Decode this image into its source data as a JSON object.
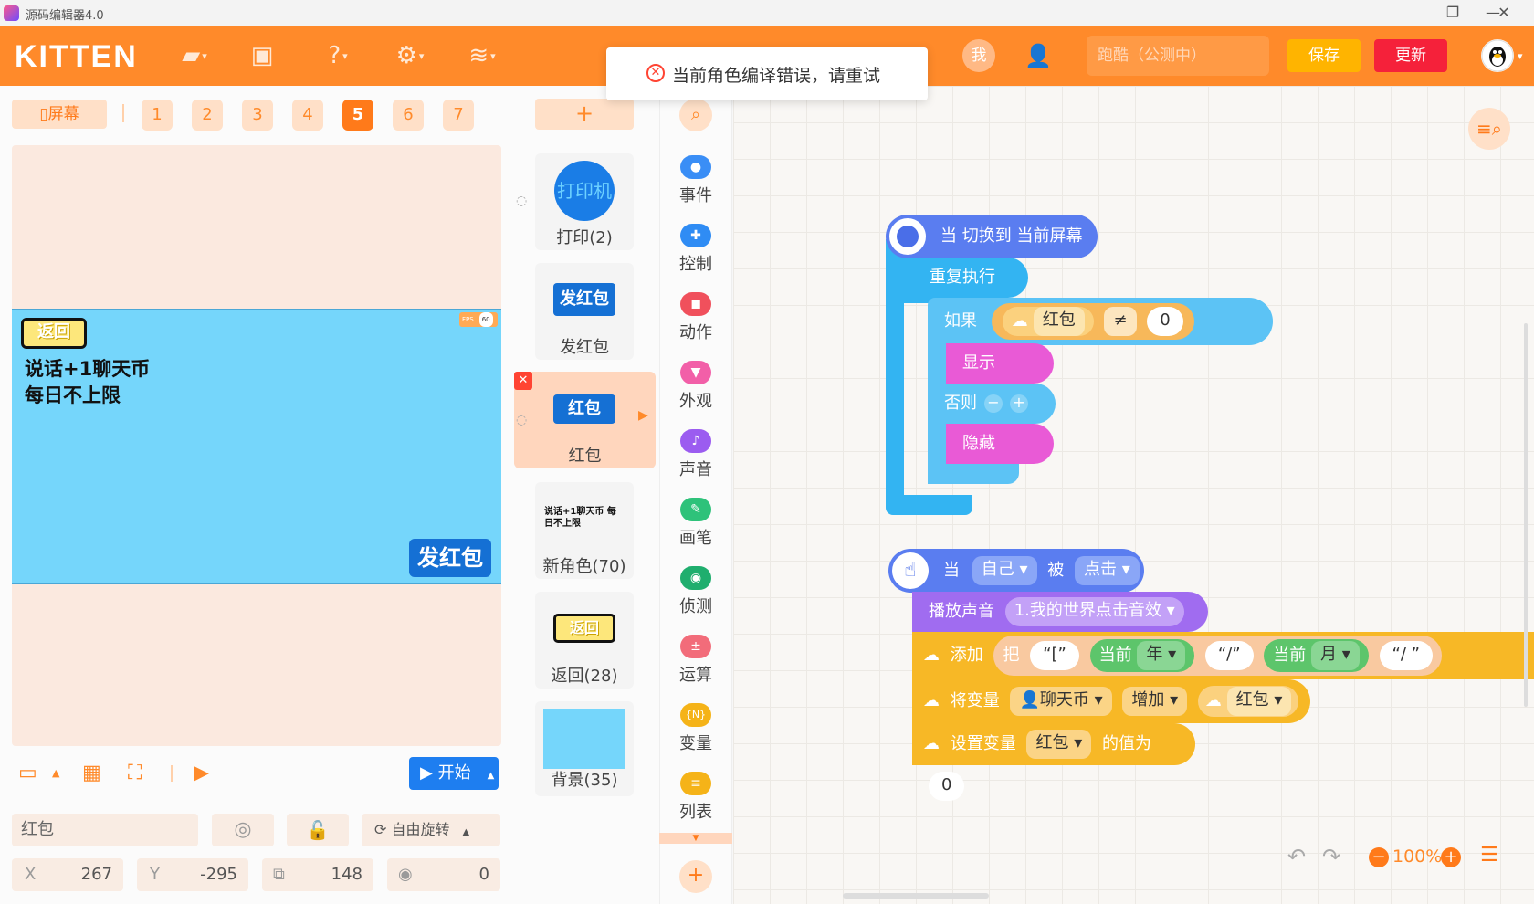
{
  "window": {
    "title": "源码编辑器4.0"
  },
  "header": {
    "logo": "KITTEN",
    "me": "我",
    "project_name": "跑酷（公测中）",
    "save": "保存",
    "update": "更新"
  },
  "toast": {
    "message": "当前角色编译错误，请重试"
  },
  "stage_tabs": {
    "screen": "屏幕",
    "pages": [
      "1",
      "2",
      "3",
      "4",
      "5",
      "6",
      "7"
    ],
    "active": "5"
  },
  "stage": {
    "back_button": "返回",
    "say_lines": [
      "说话+1聊天币",
      "每日不上限"
    ],
    "fps_label": "FPS",
    "fps_value": "60",
    "send_button": "发红包"
  },
  "controls": {
    "start": "开始"
  },
  "properties": {
    "name": "红包",
    "rotation": "自由旋转",
    "x_label": "X",
    "x": "267",
    "y_label": "Y",
    "y": "-295",
    "size": "148",
    "direction": "0"
  },
  "sprites": [
    {
      "thumb": "打印机",
      "label": "打印(2)"
    },
    {
      "thumb": "发红包",
      "label": "发红包"
    },
    {
      "thumb": "红包",
      "label": "红包"
    },
    {
      "thumb": "说话+1聊天币 每日不上限",
      "label": "新角色(70)"
    },
    {
      "thumb": "返回",
      "label": "返回(28)"
    },
    {
      "thumb": "",
      "label": "背景(35)"
    }
  ],
  "categories": [
    {
      "label": "事件",
      "color": "#3a8ef6"
    },
    {
      "label": "控制",
      "color": "#2f8cf4"
    },
    {
      "label": "动作",
      "color": "#f0505c"
    },
    {
      "label": "外观",
      "color": "#f25fa8"
    },
    {
      "label": "声音",
      "color": "#9b5cf0"
    },
    {
      "label": "画笔",
      "color": "#2ec27a"
    },
    {
      "label": "侦测",
      "color": "#1fae6e"
    },
    {
      "label": "运算",
      "color": "#f26c7a"
    },
    {
      "label": "变量",
      "color": "#f5b318"
    },
    {
      "label": "列表",
      "color": "#f5b318"
    }
  ],
  "blocks": {
    "when_switch": "当 切换到 当前屏幕",
    "forever": "重复执行",
    "if": "如果",
    "var_redbag": "红包",
    "neq": "≠",
    "zero": "0",
    "show": "显示",
    "else": "否则",
    "hide": "隐藏",
    "when": "当",
    "self": "自己",
    "by": "被",
    "clicked": "点击",
    "play_sound": "播放声音",
    "sound_name": "1.我的世界点击音效",
    "add": "添加",
    "ba": "把",
    "bracket": "“[”",
    "current1": "当前",
    "year": "年",
    "slash1": "“/”",
    "current2": "当前",
    "month": "月",
    "slash2": "“/ ”",
    "change_var": "将变量",
    "chat_coin": "聊天币",
    "increase": "增加",
    "set_var": "设置变量",
    "value_is": "的值为"
  },
  "zoom": {
    "level": "100%"
  }
}
